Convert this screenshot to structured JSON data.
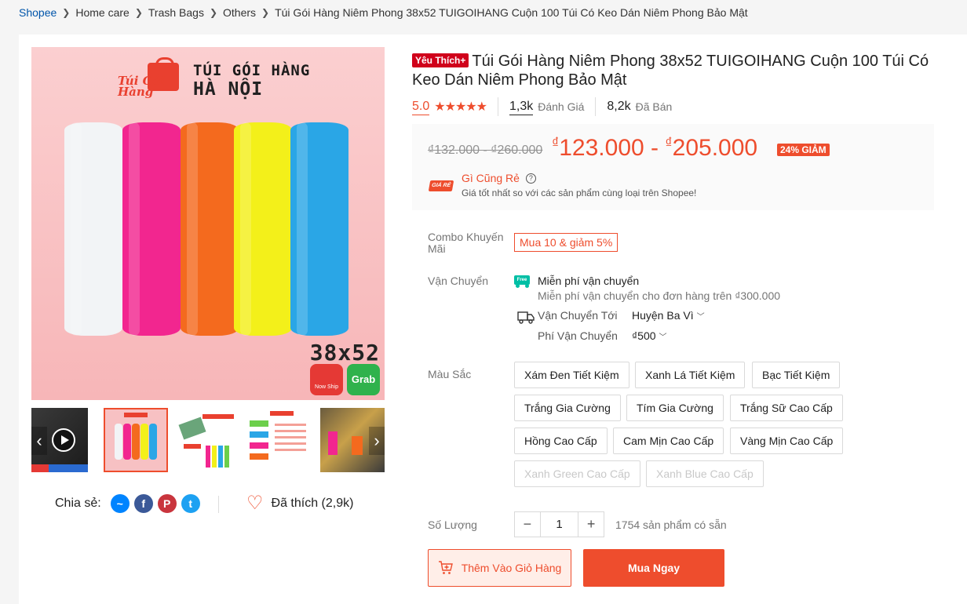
{
  "breadcrumb": {
    "items": [
      "Shopee",
      "Home care",
      "Trash Bags",
      "Others"
    ],
    "current": "Túi Gói Hàng Niêm Phong 38x52 TUIGOIHANG Cuộn 100 Túi Có Keo Dán Niêm Phong Bảo Mật"
  },
  "gallery": {
    "brand_script": "Túi Gói Hàng",
    "brand_line1": "TÚI GÓI HÀNG",
    "brand_line2": "HÀ NỘI",
    "size_label": "38x52",
    "badge_now": "Now Ship",
    "badge_grab": "Grab",
    "roll_colors": [
      "#f2f4f6",
      "#f2268f",
      "#f46a1e",
      "#f3f01a",
      "#2aa6e6"
    ]
  },
  "share": {
    "label": "Chia sẻ:",
    "like_label": "Đã thích (2,9k)"
  },
  "product": {
    "preferred_badge": "Yêu Thích+",
    "title": "Túi Gói Hàng Niêm Phong 38x52 TUIGOIHANG Cuộn 100 Túi Có Keo Dán Niêm Phong Bảo Mật",
    "rating": "5.0",
    "stars": "★★★★★",
    "reviews_count": "1,3k",
    "reviews_label": "Đánh Giá",
    "sold_count": "8,2k",
    "sold_label": "Đã Bán"
  },
  "price": {
    "original": "₫132.000 - ₫260.000",
    "currency": "₫",
    "low": "123.000",
    "dash": "-",
    "high": "205.000",
    "discount": "24% GIẢM",
    "guarantee_logo": "GIÁ RẺ",
    "guarantee_title": "Gì Cũng Rẻ",
    "guarantee_sub": "Giá tốt nhất so với các sản phẩm cùng loại trên Shopee!"
  },
  "combo": {
    "label": "Combo Khuyến Mãi",
    "tag": "Mua 10 & giảm 5%"
  },
  "shipping": {
    "label": "Vận Chuyển",
    "free_badge": "Free",
    "free_title": "Miễn phí vận chuyển",
    "free_sub": "Miễn phí vận chuyển cho đơn hàng trên ₫300.000",
    "to_label": "Vận Chuyển Tới",
    "to_value": "Huyện Ba Vì",
    "fee_label": "Phí Vận Chuyển",
    "fee_value": "₫500"
  },
  "variants": {
    "label": "Màu Sắc",
    "options": [
      "Xám Đen Tiết Kiệm",
      "Xanh Lá Tiết Kiệm",
      "Bạc Tiết Kiệm",
      "Trắng Gia Cường",
      "Tím Gia Cường",
      "Trắng Sữ Cao Cấp",
      "Hồng Cao Cấp",
      "Cam Mịn Cao Cấp",
      "Vàng Mịn Cao Cấp",
      "Xanh Green Cao Cấp",
      "Xanh Blue Cao Cấp"
    ]
  },
  "quantity": {
    "label": "Số Lượng",
    "minus": "−",
    "value": "1",
    "plus": "+",
    "stock": "1754 sản phẩm có sẵn"
  },
  "actions": {
    "add_to_cart": "Thêm Vào Giỏ Hàng",
    "buy_now": "Mua Ngay"
  },
  "colors": {
    "accent": "#ee4d2d",
    "link": "#0055aa",
    "free_ship": "#00bfa5"
  }
}
